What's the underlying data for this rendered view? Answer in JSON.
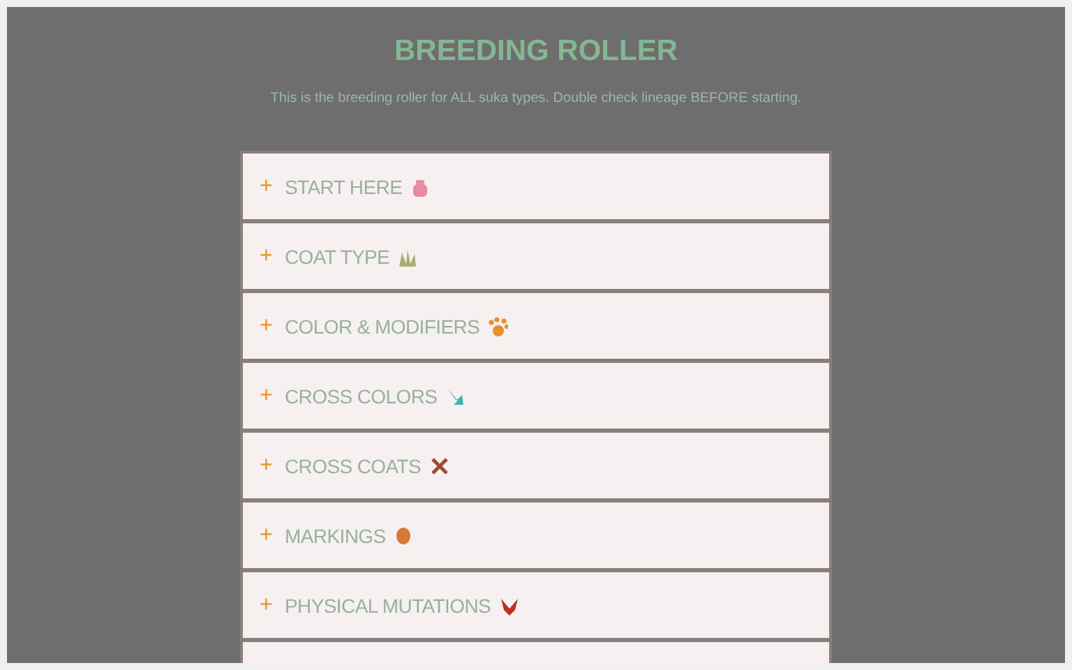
{
  "title": "BREEDING ROLLER",
  "subtitle": "This is the breeding roller for ALL suka types. Double check lineage BEFORE starting.",
  "sections": [
    {
      "toggle": "+",
      "label": "START HERE",
      "expanded": false,
      "color": "#e88aa0"
    },
    {
      "toggle": "+",
      "label": "COAT TYPE",
      "expanded": false,
      "color": "#a8b070"
    },
    {
      "toggle": "+",
      "label": "COLOR & MODIFIERS",
      "expanded": false,
      "color": "#e8902a"
    },
    {
      "toggle": "+",
      "label": "CROSS COLORS",
      "expanded": false,
      "color": "#40b0b0"
    },
    {
      "toggle": "+",
      "label": "CROSS COATS",
      "expanded": false,
      "color": "#a04838"
    },
    {
      "toggle": "+",
      "label": "MARKINGS",
      "expanded": false,
      "color": "#d87838"
    },
    {
      "toggle": "+",
      "label": "PHYSICAL MUTATIONS",
      "expanded": false,
      "color": "#c03020"
    }
  ]
}
